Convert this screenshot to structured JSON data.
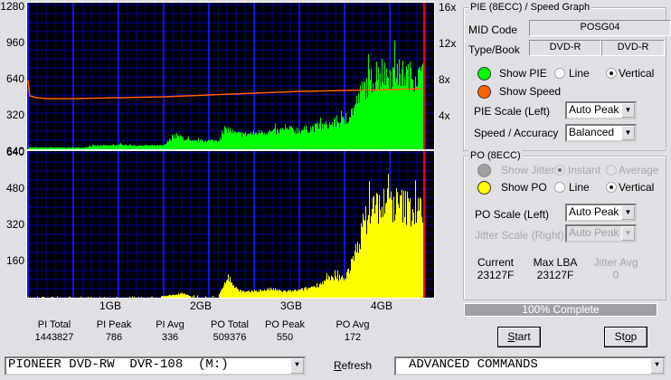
{
  "chart_data": [
    {
      "type": "bar",
      "title": "",
      "x_unit": "GB",
      "x_ticks": [
        "1GB",
        "2GB",
        "3GB",
        "4GB"
      ],
      "xlim": [
        0,
        4.52
      ],
      "left_axis": {
        "ticks": [
          "1280",
          "960",
          "640",
          "320",
          "640"
        ],
        "ylim": [
          0,
          1280
        ]
      },
      "right_axis": {
        "ticks": [
          "16x",
          "12x",
          "8x",
          "4x"
        ],
        "ylim": [
          0,
          16
        ]
      },
      "grid": true,
      "end_marker_gb": 4.38,
      "series": [
        {
          "key": "pie",
          "color": "#00ff00",
          "style": "vertical",
          "x": [
            0.0,
            0.1,
            0.2,
            0.3,
            0.4,
            0.5,
            0.6,
            0.7,
            0.8,
            0.9,
            1.0,
            1.1,
            1.2,
            1.3,
            1.4,
            1.5,
            1.6,
            1.7,
            1.8,
            1.9,
            2.0,
            2.1,
            2.2,
            2.3,
            2.4,
            2.5,
            2.6,
            2.7,
            2.8,
            2.9,
            3.0,
            3.1,
            3.2,
            3.3,
            3.4,
            3.5,
            3.6,
            3.7,
            3.8,
            3.9,
            4.0,
            4.1,
            4.2,
            4.3
          ],
          "values": [
            16,
            16,
            16,
            16,
            16,
            16,
            16,
            30,
            35,
            35,
            40,
            40,
            35,
            35,
            35,
            35,
            120,
            110,
            70,
            75,
            80,
            80,
            190,
            140,
            140,
            150,
            160,
            160,
            170,
            180,
            180,
            190,
            210,
            220,
            250,
            260,
            380,
            560,
            650,
            690,
            700,
            700,
            690,
            680
          ]
        },
        {
          "key": "speed",
          "color": "#ff6000",
          "style": "line",
          "axis": "right",
          "x": [
            0.0,
            0.02,
            0.1,
            0.2,
            0.5,
            1.0,
            1.5,
            2.0,
            2.5,
            3.0,
            3.5,
            4.0,
            4.35
          ],
          "values": [
            7.6,
            5.9,
            5.7,
            5.6,
            5.6,
            5.7,
            5.8,
            6.0,
            6.2,
            6.4,
            6.5,
            6.6,
            6.7
          ]
        }
      ]
    },
    {
      "type": "bar",
      "title": "",
      "x_unit": "GB",
      "xlim": [
        0,
        4.52
      ],
      "left_axis": {
        "ticks": [
          "640",
          "480",
          "320",
          "160"
        ],
        "ylim": [
          0,
          640
        ]
      },
      "grid": true,
      "end_marker_gb": 4.38,
      "series": [
        {
          "key": "po",
          "color": "#ffff00",
          "style": "vertical",
          "x": [
            0.0,
            0.1,
            0.2,
            0.3,
            0.4,
            0.5,
            0.6,
            0.7,
            0.8,
            0.9,
            1.0,
            1.1,
            1.2,
            1.3,
            1.4,
            1.5,
            1.6,
            1.7,
            1.8,
            1.9,
            2.0,
            2.1,
            2.2,
            2.3,
            2.4,
            2.5,
            2.6,
            2.7,
            2.8,
            2.9,
            3.0,
            3.1,
            3.2,
            3.3,
            3.4,
            3.5,
            3.6,
            3.7,
            3.8,
            3.9,
            4.0,
            4.1,
            4.2,
            4.3
          ],
          "values": [
            2,
            2,
            2,
            2,
            2,
            2,
            2,
            2,
            2,
            2,
            2,
            2,
            2,
            2,
            2,
            8,
            12,
            20,
            6,
            4,
            4,
            4,
            100,
            40,
            25,
            30,
            35,
            40,
            30,
            30,
            35,
            45,
            60,
            80,
            90,
            95,
            180,
            330,
            420,
            430,
            440,
            430,
            420,
            400
          ]
        }
      ]
    }
  ],
  "stats": [
    {
      "label": "PI Total",
      "value": "1443827"
    },
    {
      "label": "PI Peak",
      "value": "786"
    },
    {
      "label": "PI Avg",
      "value": "336"
    },
    {
      "label": "PO Total",
      "value": "509376"
    },
    {
      "label": "PO Peak",
      "value": "550"
    },
    {
      "label": "PO Avg",
      "value": "172"
    }
  ],
  "pie_group": {
    "title": "PIE (8ECC) / Speed Graph",
    "mid_label": "MID Code",
    "mid_value": "POSG04",
    "type_label": "Type/Book",
    "type_value": "DVD-R",
    "book_value": "DVD-R",
    "show_pie": "Show PIE",
    "show_speed": "Show Speed",
    "line": "Line",
    "vertical": "Vertical",
    "scale_label": "PIE Scale (Left)",
    "scale_value": "Auto Peak",
    "accuracy_label": "Speed / Accuracy",
    "accuracy_value": "Balanced",
    "pie_color": "#00ff00",
    "speed_color": "#ff6000"
  },
  "po_group": {
    "title": "PO (8ECC)",
    "show_jitter": "Show Jitter",
    "instant": "Instant",
    "average": "Average",
    "show_po": "Show PO",
    "line": "Line",
    "vertical": "Vertical",
    "scale_label": "PO Scale (Left)",
    "scale_value": "Auto Peak",
    "jitter_scale_label": "Jitter Scale (Right)",
    "jitter_scale_value": "Auto Peak",
    "current_label": "Current",
    "current_value": "23127F",
    "maxlba_label": "Max LBA",
    "maxlba_value": "23127F",
    "jitter_avg_label": "Jitter Avg",
    "jitter_avg_value": "0",
    "po_color": "#ffff00"
  },
  "progress": {
    "text": "100% Complete",
    "percent": 100
  },
  "buttons": {
    "start": "Start",
    "stop": "Stop",
    "refresh": "Refresh"
  },
  "drive": {
    "value": "PIONEER DVD-RW  DVR-108  (M:)"
  },
  "commands": {
    "value": "ADVANCED COMMANDS"
  }
}
